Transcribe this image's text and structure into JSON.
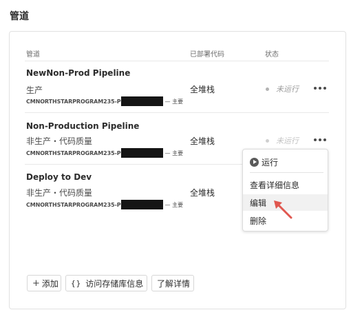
{
  "page": {
    "title": "管道"
  },
  "table": {
    "headers": {
      "pipeline": "管道",
      "deployed_code": "已部署代码",
      "status": "状态"
    }
  },
  "pipelines": [
    {
      "name": "NewNon-Prod Pipeline",
      "desc": "生产",
      "repo": "CMNORTHSTARPROGRAM235-P",
      "branch": "— 主要",
      "code": "全堆栈",
      "status": "未运行"
    },
    {
      "name": "Non-Production Pipeline",
      "desc": "非生产・代码质量",
      "repo": "CMNORTHSTARPROGRAM235-P",
      "branch": "— 主要",
      "code": "全堆栈",
      "status": "未运行"
    },
    {
      "name": "Deploy to Dev",
      "desc": "非生产・代码质量",
      "repo": "CMNORTHSTARPROGRAM235-P",
      "branch": "— 主要",
      "code": "全堆栈"
    }
  ],
  "menu": {
    "run": "运行",
    "view_details": "查看详细信息",
    "edit": "编辑",
    "delete": "删除"
  },
  "footer": {
    "add": "添加",
    "repo_info": "访问存储库信息",
    "learn_more": "了解详情"
  },
  "icons": {
    "more": "more-icon",
    "play": "play-icon",
    "plus": "plus-icon",
    "braces": "braces-icon",
    "arrow": "red-arrow-annotation"
  },
  "colors": {
    "annotation_arrow": "#e0574f",
    "status_dot": "#b3b3b3"
  }
}
